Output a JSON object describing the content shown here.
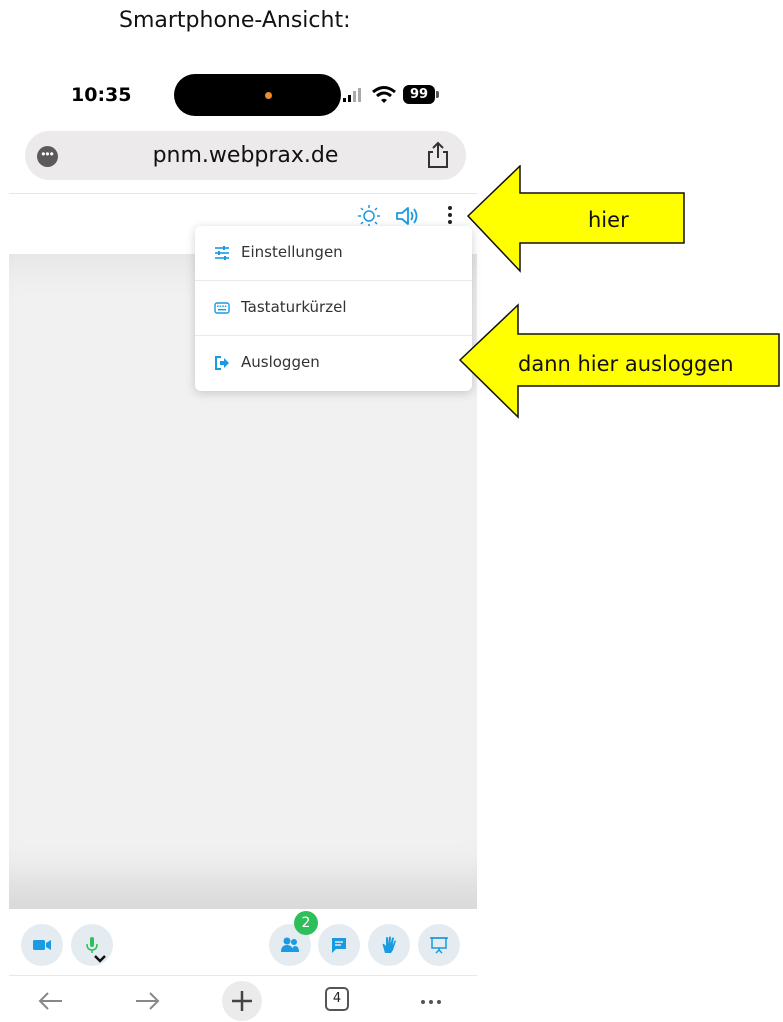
{
  "caption": "Smartphone-Ansicht:",
  "status_bar": {
    "time": "10:35",
    "battery": "99"
  },
  "browser": {
    "url": "pnm.webprax.de"
  },
  "menu": {
    "items": [
      {
        "label": "Einstellungen",
        "icon": "sliders-icon"
      },
      {
        "label": "Tastaturkürzel",
        "icon": "keyboard-icon"
      },
      {
        "label": "Ausloggen",
        "icon": "logout-icon"
      }
    ]
  },
  "callouts": {
    "first": "hier",
    "second": "dann hier ausloggen"
  },
  "controls": {
    "participants_count": "2"
  },
  "browser_nav": {
    "tabs_count": "4"
  },
  "colors": {
    "accent": "#1a9ae0",
    "mic": "#2fbf5a",
    "callout": "#ffff00"
  }
}
